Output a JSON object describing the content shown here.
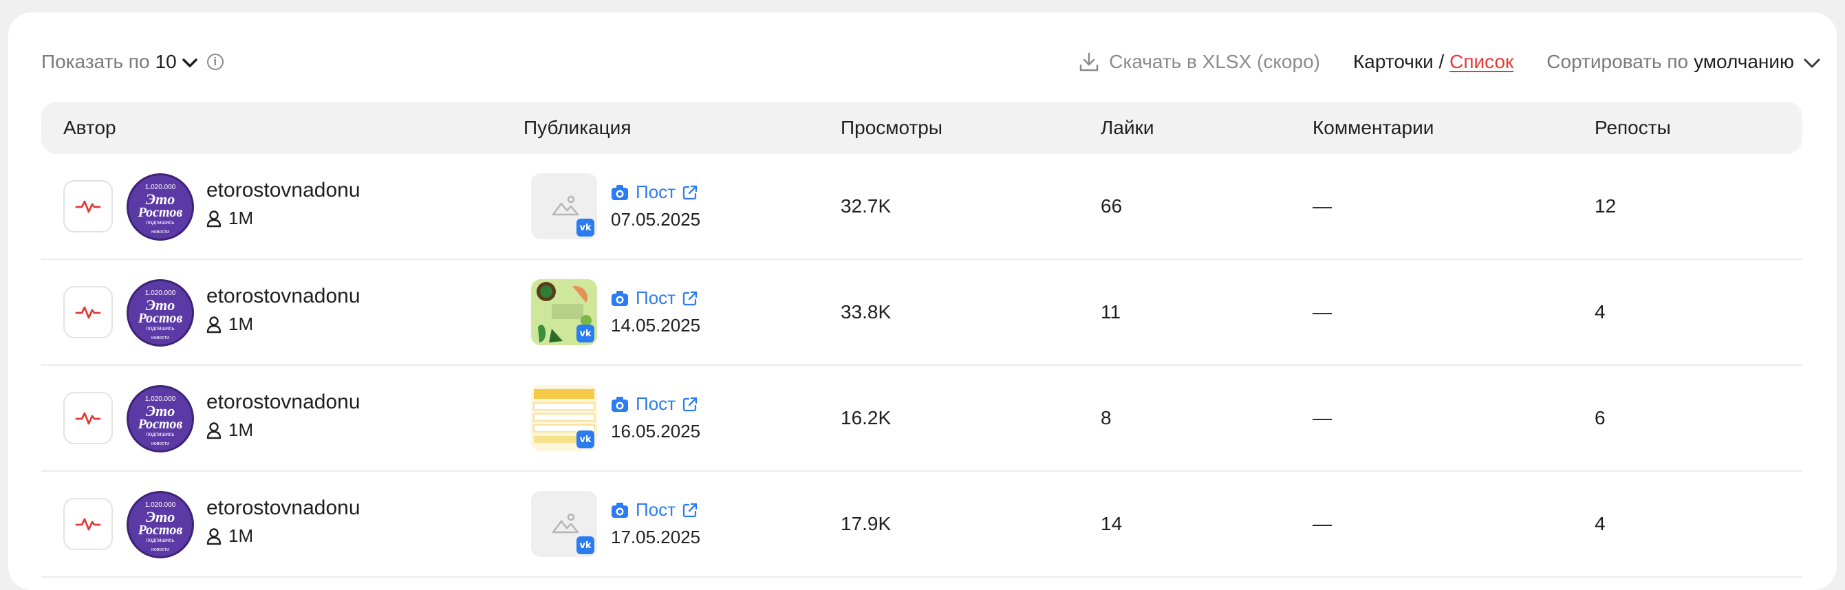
{
  "toolbar": {
    "show_per_label": "Показать по",
    "show_per_value": "10",
    "download_label": "Скачать в XLSX (скоро)",
    "view_cards": "Карточки",
    "view_separator": " / ",
    "view_list": "Список",
    "sort_label": "Сортировать по",
    "sort_value": "умолчанию"
  },
  "table": {
    "columns": [
      "Автор",
      "Публикация",
      "Просмотры",
      "Лайки",
      "Комментарии",
      "Репосты"
    ],
    "rows": [
      {
        "author": "etorostovnadonu",
        "followers": "1M",
        "post_label": "Пост",
        "date": "07.05.2025",
        "views": "32.7K",
        "likes": "66",
        "comments": "—",
        "reposts": "12",
        "thumb": "placeholder"
      },
      {
        "author": "etorostovnadonu",
        "followers": "1M",
        "post_label": "Пост",
        "date": "14.05.2025",
        "views": "33.8K",
        "likes": "11",
        "comments": "—",
        "reposts": "4",
        "thumb": "green-image"
      },
      {
        "author": "etorostovnadonu",
        "followers": "1M",
        "post_label": "Пост",
        "date": "16.05.2025",
        "views": "16.2K",
        "likes": "8",
        "comments": "—",
        "reposts": "6",
        "thumb": "yellow-image"
      },
      {
        "author": "etorostovnadonu",
        "followers": "1M",
        "post_label": "Пост",
        "date": "17.05.2025",
        "views": "17.9K",
        "likes": "14",
        "comments": "—",
        "reposts": "4",
        "thumb": "placeholder"
      }
    ],
    "avatar_text": {
      "top": "1.020.000",
      "main1": "Этo",
      "main2": "Ростов",
      "sub": "подпишись",
      "bottom": "новости"
    },
    "vk_badge": "vk"
  },
  "colors": {
    "accent": "#e53935",
    "link": "#2b7cf0",
    "avatar": "#5c3aa6"
  }
}
